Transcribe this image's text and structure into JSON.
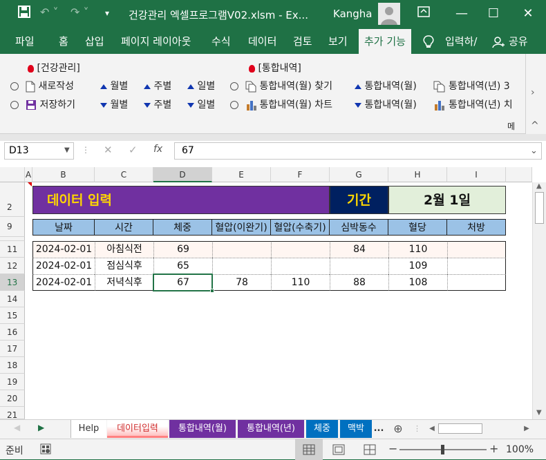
{
  "window": {
    "title": "건강관리 엑셀프로그램V02.xlsm  -  Ex...",
    "user": "Kangha",
    "min": "—",
    "max": "☐",
    "close": "✕"
  },
  "ribbon_tabs": [
    "파일",
    "홈",
    "삽입",
    "페이지 레이아웃",
    "수식",
    "데이터",
    "검토",
    "보기",
    "추가 기능"
  ],
  "tell_me": "입력하/",
  "share": "공유",
  "group1": {
    "title": "[건강관리]",
    "new": "새로작성",
    "save": "저장하기",
    "monthly": "월별",
    "weekly": "주별",
    "daily": "일별"
  },
  "group2": {
    "title": "[통합내역]",
    "find": "통합내역(월) 찾기",
    "chart": "통합내역(월) 차트",
    "month": "통합내역(월)",
    "year1": "통합내역(년) 3",
    "year2": "통합내역(년) 치"
  },
  "ribbon_more": "메",
  "formula": {
    "namebox": "D13",
    "fx": "fx",
    "value": "67"
  },
  "columns": [
    "A",
    "B",
    "C",
    "D",
    "E",
    "F",
    "G",
    "H",
    "I"
  ],
  "rows": [
    "2",
    "9",
    "11",
    "12",
    "13",
    "14",
    "15",
    "16",
    "17",
    "18",
    "19",
    "20",
    "21"
  ],
  "banner": {
    "title": "데이터 입력",
    "period_label": "기간",
    "period_value": "2월 1일"
  },
  "headers": [
    "날짜",
    "시간",
    "체중",
    "혈압(이완기)",
    "혈압(수축기)",
    "심박동수",
    "혈당",
    "처방"
  ],
  "table_rows": [
    [
      "2024-02-01",
      "아침식전",
      "69",
      "",
      "",
      "84",
      "110",
      ""
    ],
    [
      "2024-02-01",
      "점심식후",
      "65",
      "",
      "",
      "",
      "109",
      ""
    ],
    [
      "2024-02-01",
      "저녁식후",
      "67",
      "78",
      "110",
      "88",
      "108",
      ""
    ]
  ],
  "sheet_tabs": [
    "Help",
    "데이터입력",
    "통합내역(월)",
    "통합내역(년)",
    "체중",
    "맥박"
  ],
  "sheet_more": "...",
  "status": {
    "ready": "준비",
    "zoom": "100%"
  },
  "colors": {
    "excel_green": "#1f7145",
    "banner_purple": "#7030a0",
    "banner_title": "#ffd700",
    "period_navy": "#002060",
    "period_bg": "#e2efda",
    "header_blue": "#9bc2e6"
  }
}
